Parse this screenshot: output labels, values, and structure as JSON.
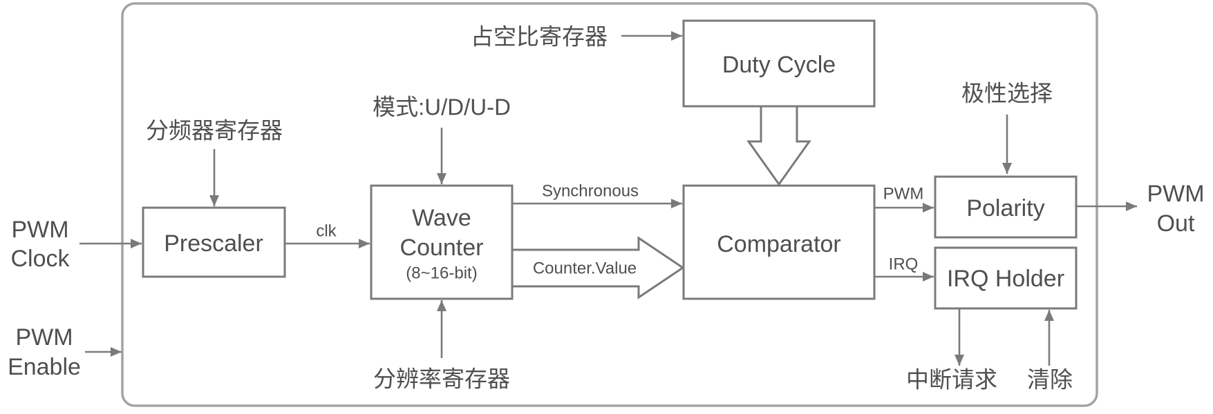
{
  "colors": {
    "stroke": "#7a7a7a",
    "frame": "#a3a3a3",
    "text": "#4f4f4f",
    "background": "#ffffff"
  },
  "inputs": {
    "pwm_clock": {
      "line1": "PWM",
      "line2": "Clock"
    },
    "pwm_enable": {
      "line1": "PWM",
      "line2": "Enable"
    }
  },
  "output": {
    "pwm_out": {
      "line1": "PWM",
      "line2": "Out"
    }
  },
  "blocks": {
    "prescaler": {
      "label": "Prescaler",
      "register": "分频器寄存器"
    },
    "wave_counter": {
      "line1": "Wave",
      "line2": "Counter",
      "width_note": "(8~16-bit)",
      "mode": "模式:U/D/U-D",
      "register": "分辨率寄存器"
    },
    "duty_cycle": {
      "label": "Duty Cycle",
      "register": "占空比寄存器"
    },
    "comparator": {
      "label": "Comparator"
    },
    "polarity": {
      "label": "Polarity",
      "select": "极性选择"
    },
    "irq_holder": {
      "label": "IRQ Holder",
      "request": "中断请求",
      "clear": "清除"
    }
  },
  "signals": {
    "clk": "clk",
    "synchronous": "Synchronous",
    "counter_value": "Counter.Value",
    "pwm": "PWM",
    "irq": "IRQ"
  }
}
